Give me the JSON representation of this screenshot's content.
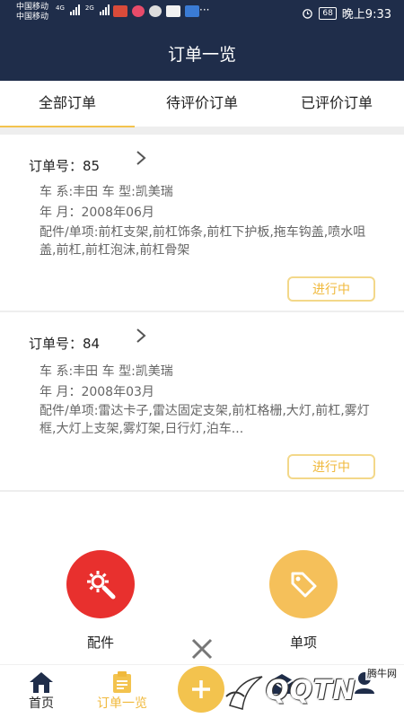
{
  "status_bar": {
    "carrier1": "中国移动",
    "carrier2": "中国移动",
    "net1": "4G",
    "net2": "2G",
    "dots": "···",
    "battery": "68",
    "time": "晚上9:33"
  },
  "header": {
    "title": "订单一览"
  },
  "tabs": [
    {
      "label": "全部订单",
      "active": true
    },
    {
      "label": "待评价订单",
      "active": false
    },
    {
      "label": "已评价订单",
      "active": false
    }
  ],
  "orders": [
    {
      "order_no": "订单号：85",
      "car": "车 系:丰田 车 型:凯美瑞",
      "year": "年 月：2008年06月",
      "parts": "配件/单项:前杠支架,前杠饰条,前杠下护板,拖车钩盖,喷水咀盖,前杠,前杠泡沫,前杠骨架",
      "status": "进行中"
    },
    {
      "order_no": "订单号：84",
      "car": "车 系:丰田 车 型:凯美瑞",
      "year": "年 月：2008年03月",
      "parts": "配件/单项:雷达卡子,雷达固定支架,前杠格栅,大灯,前杠,雾灯框,大灯上支架,雾灯架,日行灯,泊车...",
      "status": "进行中"
    }
  ],
  "actions": [
    {
      "label": "配件",
      "color": "#e8302e"
    },
    {
      "label": "单项",
      "color": "#f5c05a"
    }
  ],
  "bottom_nav": [
    {
      "label": "首页",
      "icon": "home-icon"
    },
    {
      "label": "订单一览",
      "icon": "clipboard-icon",
      "active": true
    },
    {
      "label": "",
      "icon": "mail-icon"
    },
    {
      "label": "",
      "icon": "user-icon"
    }
  ],
  "watermark": {
    "text": "QQTN",
    "small": "腾牛网"
  },
  "colors": {
    "header_bg": "#1f2d4a",
    "accent": "#f3c34e",
    "status_text": "#f0b93c"
  }
}
